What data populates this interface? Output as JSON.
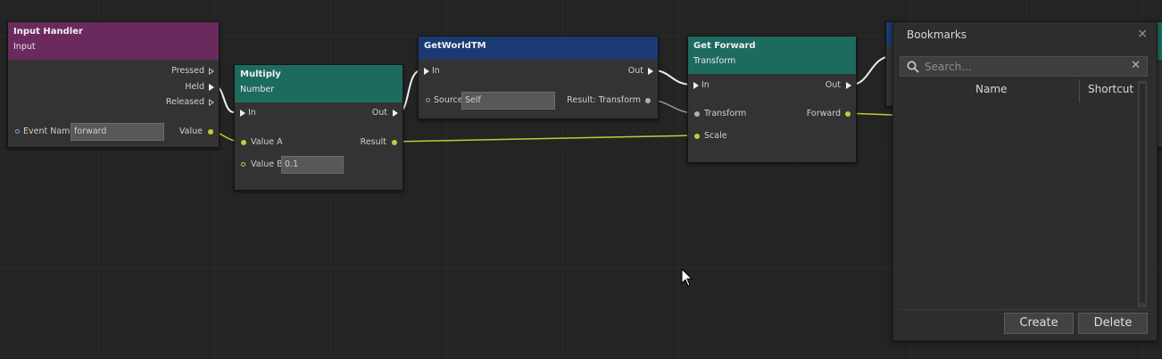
{
  "nodes": {
    "input_handler": {
      "title": "Input Handler",
      "subtitle": "Input",
      "header_color": "#6b2a5e",
      "outputs": {
        "pressed": "Pressed",
        "held": "Held",
        "released": "Released",
        "value": "Value"
      },
      "event_name_label": "Event Name",
      "event_name_value": "forward"
    },
    "multiply": {
      "title": "Multiply",
      "subtitle": "Number",
      "header_color": "#1d6b5e",
      "in": "In",
      "out": "Out",
      "value_a": "Value A",
      "value_b": "Value B",
      "value_b_value": "0.1",
      "result": "Result"
    },
    "get_world_tm": {
      "title": "GetWorldTM",
      "header_color": "#1c3a72",
      "in": "In",
      "out": "Out",
      "source_label": "Source",
      "source_value": "Self",
      "result": "Result: Transform"
    },
    "get_forward": {
      "title": "Get Forward",
      "subtitle": "Transform",
      "header_color": "#1d6b5e",
      "in": "In",
      "out": "Out",
      "transform": "Transform",
      "forward": "Forward",
      "scale": "Scale"
    }
  },
  "bookmarks": {
    "title": "Bookmarks",
    "close_glyph": "×",
    "search_placeholder": "Search...",
    "clear_glyph": "✕",
    "columns": [
      "Name",
      "Shortcut"
    ],
    "create_label": "Create",
    "delete_label": "Delete"
  },
  "colors": {
    "wire_exec": "#f0f0f0",
    "wire_data": "#c8c83a",
    "canvas": "#242424"
  }
}
